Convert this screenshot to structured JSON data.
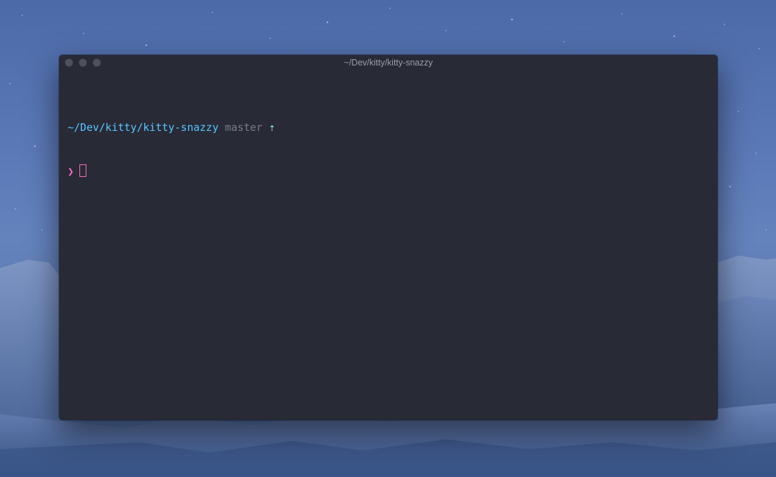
{
  "window": {
    "title": "~/Dev/kitty/kitty-snazzy"
  },
  "terminal": {
    "path": "~/Dev/kitty/kitty-snazzy",
    "branch": "master",
    "ahead_indicator": "⇡",
    "prompt_symbol": "❯",
    "input": ""
  },
  "colors": {
    "background": "#282a36",
    "path": "#57c7ff",
    "branch": "#7a7c86",
    "ahead": "#9aedfe",
    "prompt": "#ff6ac1"
  }
}
